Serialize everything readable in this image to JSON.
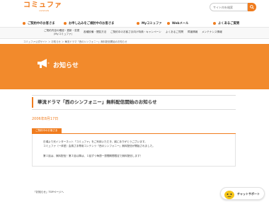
{
  "header": {
    "logo_text": "コミュファ",
    "logo_sub": "commufa",
    "search_placeholder": "サイト内を検索"
  },
  "main_nav": [
    {
      "label": "ご契約中のお客さま"
    },
    {
      "label": "お申し込みをご検討中のお客さま"
    },
    {
      "label": "Myコミュファ"
    },
    {
      "label": "Webメール"
    },
    {
      "label": "よくあるご質問"
    }
  ],
  "sub_nav": {
    "item1_line1": "ご契約内容の確認・更新・変更",
    "item1_line2": "(Myコミュファ)",
    "item2": "各種設備・閲覧方法",
    "item3": "ご契約中のお客さま向け特典・キャンペーン",
    "item4": "よくあるご質問",
    "item5": "障害情報",
    "item6": "メンテナンス情報"
  },
  "breadcrumb": "コミュファ公式サイト ＞ お知らせ ＞ 華流ドラマ「西のシンフォニー」無料配信開始のお知らせ",
  "banner": {
    "title": "お知らせ",
    "color": "#f28a2c"
  },
  "article": {
    "title": "華流ドラマ「西のシンフォニー」無料配信開始のお知らせ",
    "date": "2006年8月17日",
    "category": "ご契約中のお客さま",
    "paragraphs": [
      "日頃より光インターネット「コミュファ」をご利用いただき、誠にありがとうございます。",
      "コミュファ（一体型）会員さま専用コンテンツ「西のシンフォニー」無料配信が開始されました。",
      "第１話は、無料配信！第２話以降は、１話ずつ毎週一週間期間限定で無料配信します！"
    ]
  },
  "back_link": "「お知らせ」TOPページへ",
  "chat": {
    "label": "チャットサポート"
  },
  "colors": {
    "accent": "#f07c1e"
  }
}
